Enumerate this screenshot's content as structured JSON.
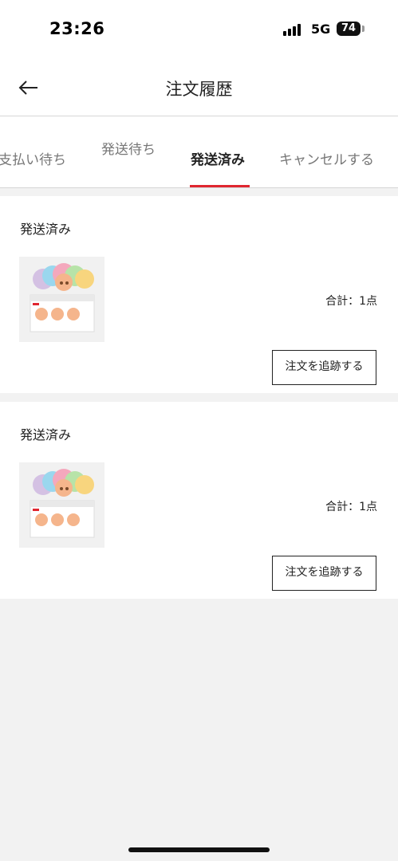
{
  "status_bar": {
    "time": "23:26",
    "network": "5G",
    "battery": "74"
  },
  "header": {
    "title": "注文履歴"
  },
  "tabs": [
    {
      "label": "支払い待ち",
      "active": false
    },
    {
      "label": "発送待ち",
      "active": false
    },
    {
      "label": "発送済み",
      "active": true
    },
    {
      "label": "キャンセルする",
      "active": false
    }
  ],
  "orders": [
    {
      "status": "発送済み",
      "total": "合計：1点",
      "track_label": "注文を追跡する"
    },
    {
      "status": "発送済み",
      "total": "合計：1点",
      "track_label": "注文を追跡する"
    }
  ],
  "colors": {
    "accent": "#e0262f",
    "background": "#f2f2f2"
  }
}
